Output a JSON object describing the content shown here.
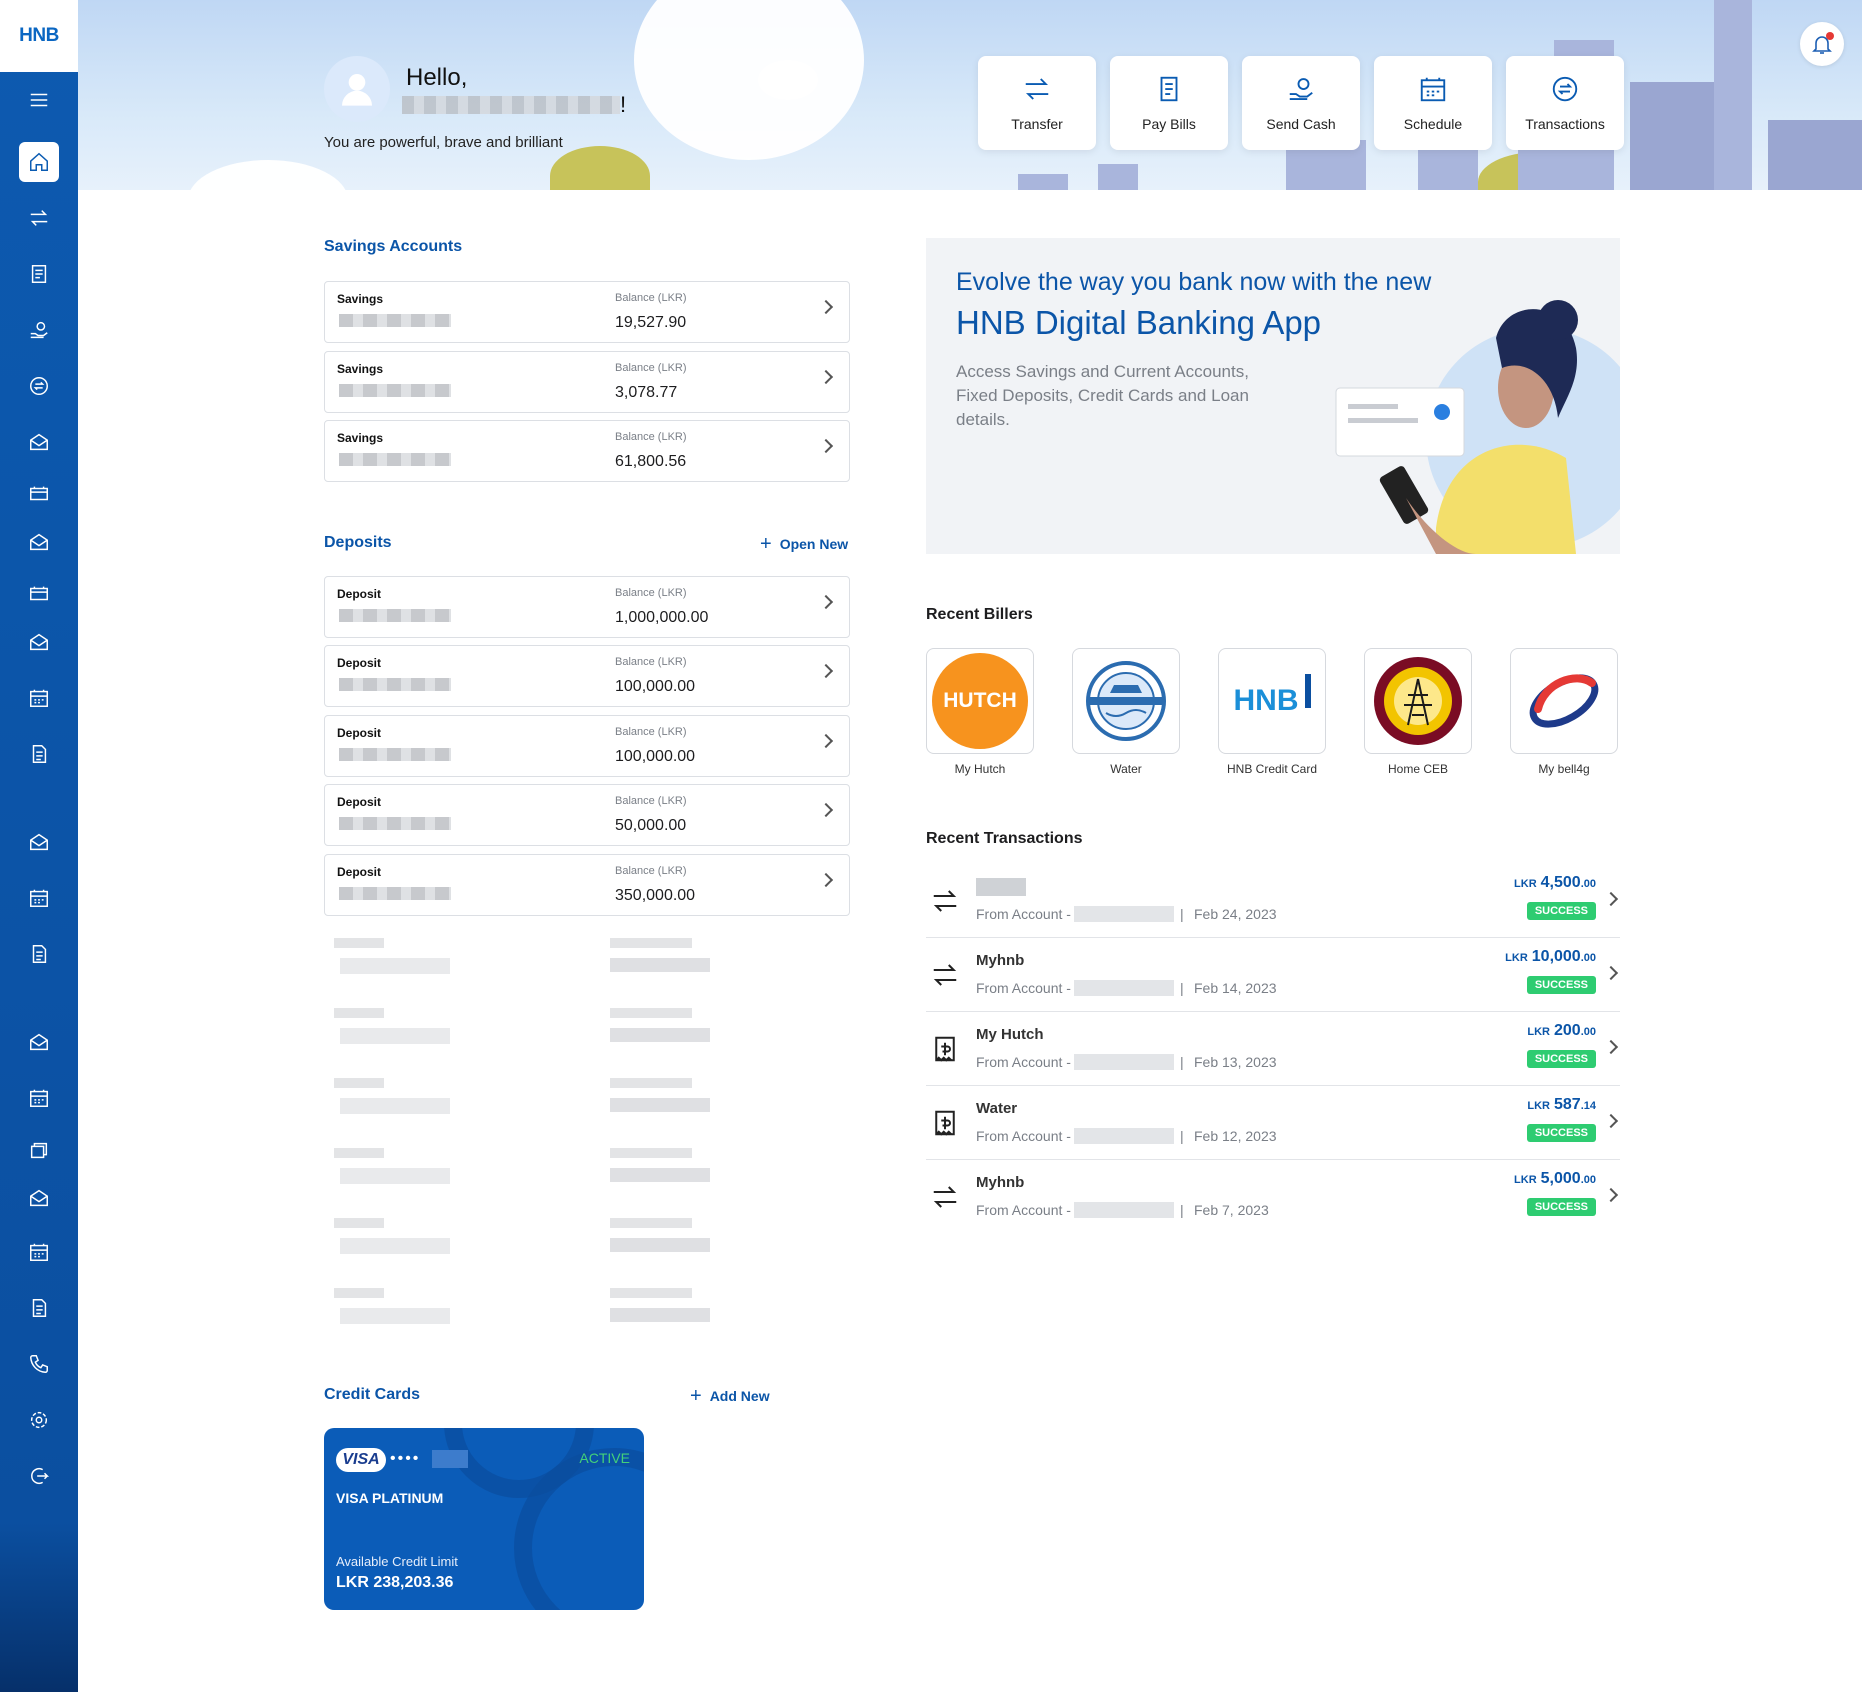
{
  "brand": {
    "logo": "HNB",
    "accent": "#0b55a8",
    "success": "#2ecc71"
  },
  "sidebar": {
    "icons": [
      "menu-icon",
      "home-icon",
      "transfer-icon",
      "bill-icon",
      "send-cash-icon",
      "transactions-icon",
      "mail-icon",
      "calendar-icon",
      "mail-icon",
      "calendar-icon",
      "mail-icon",
      "calendar-icon",
      "document-icon",
      "mail-icon",
      "calendar-icon",
      "document-icon",
      "mail-icon",
      "calendar-icon",
      "bill-icon",
      "mail-icon",
      "calendar-icon",
      "document-icon",
      "phone-icon",
      "settings-icon",
      "logout-icon"
    ]
  },
  "header": {
    "hello": "Hello,",
    "exclamation": "!",
    "tagline": "You are powerful, brave and brilliant",
    "quick_actions": [
      {
        "label": "Transfer",
        "icon": "transfer-icon"
      },
      {
        "label": "Pay Bills",
        "icon": "bill-icon"
      },
      {
        "label": "Send Cash",
        "icon": "send-cash-icon"
      },
      {
        "label": "Schedule",
        "icon": "calendar-icon"
      },
      {
        "label": "Transactions",
        "icon": "transactions-icon"
      }
    ]
  },
  "savings": {
    "title": "Savings Accounts",
    "accounts": [
      {
        "type": "Savings",
        "balance_label": "Balance (LKR)",
        "balance": "19,527.90"
      },
      {
        "type": "Savings",
        "balance_label": "Balance (LKR)",
        "balance": "3,078.77"
      },
      {
        "type": "Savings",
        "balance_label": "Balance (LKR)",
        "balance": "61,800.56"
      }
    ]
  },
  "deposits": {
    "title": "Deposits",
    "open_new": "Open New",
    "accounts": [
      {
        "type": "Deposit",
        "balance_label": "Balance (LKR)",
        "balance": "1,000,000.00"
      },
      {
        "type": "Deposit",
        "balance_label": "Balance (LKR)",
        "balance": "100,000.00"
      },
      {
        "type": "Deposit",
        "balance_label": "Balance (LKR)",
        "balance": "100,000.00"
      },
      {
        "type": "Deposit",
        "balance_label": "Balance (LKR)",
        "balance": "50,000.00"
      },
      {
        "type": "Deposit",
        "balance_label": "Balance (LKR)",
        "balance": "350,000.00"
      }
    ]
  },
  "credit_cards": {
    "title": "Credit Cards",
    "add_new": "Add New",
    "card": {
      "network": "VISA",
      "dots": "••••",
      "status": "ACTIVE",
      "name": "VISA PLATINUM",
      "limit_label": "Available Credit Limit",
      "limit": "LKR 238,203.36"
    }
  },
  "promo": {
    "line1": "Evolve the way you bank now with the new",
    "line2": "HNB Digital Banking App",
    "description": "Access Savings and Current Accounts, Fixed Deposits, Credit Cards and Loan details."
  },
  "billers": {
    "title": "Recent Billers",
    "items": [
      {
        "label": "My Hutch",
        "logo_text": "HUTCH"
      },
      {
        "label": "Water",
        "logo_text": ""
      },
      {
        "label": "HNB Credit Card",
        "logo_text": "HNB"
      },
      {
        "label": "Home CEB",
        "logo_text": ""
      },
      {
        "label": "My bell4g",
        "logo_text": ""
      }
    ]
  },
  "transactions": {
    "title": "Recent Transactions",
    "items": [
      {
        "name": "",
        "from": "From Account -",
        "sep": "|",
        "date": "Feb 24, 2023",
        "currency": "LKR",
        "amount": "4,500",
        "decimals": ".00",
        "status": "SUCCESS",
        "icon": "transfer-icon"
      },
      {
        "name": "Myhnb",
        "from": "From Account -",
        "sep": "|",
        "date": "Feb 14, 2023",
        "currency": "LKR",
        "amount": "10,000",
        "decimals": ".00",
        "status": "SUCCESS",
        "icon": "transfer-icon"
      },
      {
        "name": "My Hutch",
        "from": "From Account -",
        "sep": "|",
        "date": "Feb 13, 2023",
        "currency": "LKR",
        "amount": "200",
        "decimals": ".00",
        "status": "SUCCESS",
        "icon": "bill-icon"
      },
      {
        "name": "Water",
        "from": "From Account -",
        "sep": "|",
        "date": "Feb 12, 2023",
        "currency": "LKR",
        "amount": "587",
        "decimals": ".14",
        "status": "SUCCESS",
        "icon": "bill-icon"
      },
      {
        "name": "Myhnb",
        "from": "From Account -",
        "sep": "|",
        "date": "Feb 7, 2023",
        "currency": "LKR",
        "amount": "5,000",
        "decimals": ".00",
        "status": "SUCCESS",
        "icon": "transfer-icon"
      }
    ]
  }
}
